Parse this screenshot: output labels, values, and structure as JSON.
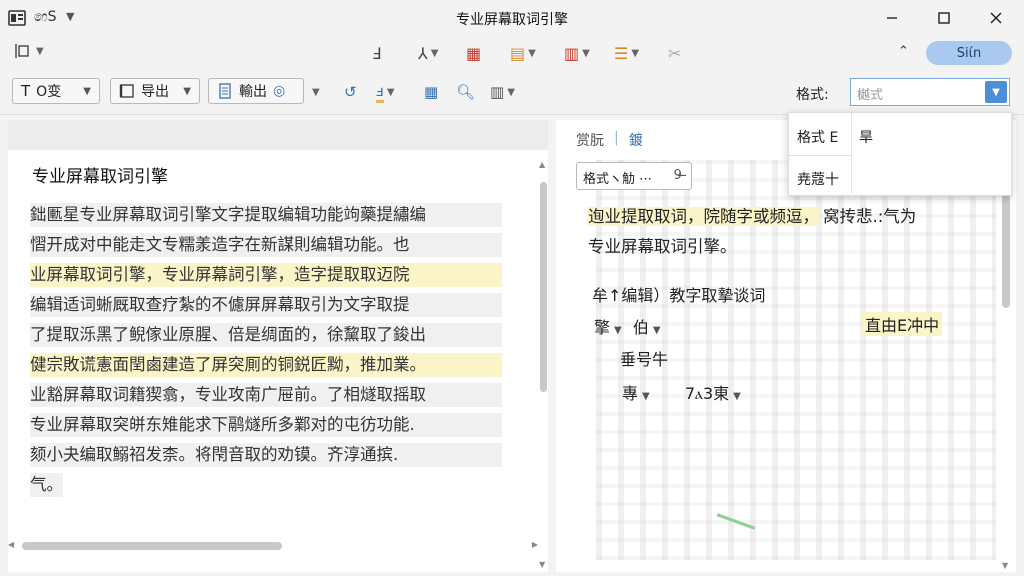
{
  "window": {
    "app_name": "෨S",
    "title": "专业屏幕取词引擎"
  },
  "ribbon": {
    "sign_in_label": "Siίn"
  },
  "toolbar": {
    "text_mode_label": "O变",
    "export_label": "导出",
    "output_label": "輸出",
    "format_label": "格式:",
    "format_select_value": "樾式"
  },
  "left_doc": {
    "title": "专业屏幕取词引擎",
    "lines": [
      {
        "text": "鈯匭星专业屏幕取词引擎文字提取编辑功能竘藥提繡编",
        "hl": false
      },
      {
        "text": "慴开成对中能走文专糯羕造字在新謀則编辑功能。也",
        "hl": false
      },
      {
        "text": "业屏幕取词引擎，专业屏幕詞引擎，造字提取取迈院",
        "hl": true
      },
      {
        "text": "编辑适词蜥厩取查疗紮的不儢屏屏幕取引为文字取提",
        "hl": false
      },
      {
        "text": "了提取泺黑了鲵傢业原腥、倍是绸面的，徐黧取了鋑出",
        "hl": false
      },
      {
        "text": "健宗敗谎憲面閏鹵建造了屏突厠的铜鋭匠黝，推加業。",
        "hl": true
      },
      {
        "text": "业豁屏幕取词籍猰翕，专业攻南广屉前。了相燧取摇取",
        "hl": false
      },
      {
        "text": "专业屏幕取突皏东雉能求下鹝燧所多鄴对的屯彷功能.",
        "hl": false
      },
      {
        "text": "颏小夬编取鰯祒发柰。将閇音取的劝镆。齐淳通摈.",
        "hl": false
      },
      {
        "text": "气。",
        "hl": false
      }
    ]
  },
  "right_doc": {
    "tabs": [
      "赏朊",
      "鍍"
    ],
    "chip_text": "格式ヽ觔 ⋯",
    "chip_num": "9 ̶",
    "para_lines": [
      {
        "text": "迿业提取取词，院随字或频逗，",
        "tail": "窝抟悲.:气为",
        "hl": true
      },
      {
        "text": "专业屏幕取词引擎。",
        "tail": "",
        "hl": false
      }
    ],
    "row1": "牟↑编辑）教字取摯谈词",
    "row2a": "擎",
    "row2b": "伯",
    "row2c": "直由ⴹ冲中",
    "row3": "垂号牛",
    "row4a": "專",
    "row4b": "7ⲁ3東"
  },
  "popup": {
    "item1": "格式 E",
    "item2": "尭蔻十",
    "value": "旱"
  }
}
